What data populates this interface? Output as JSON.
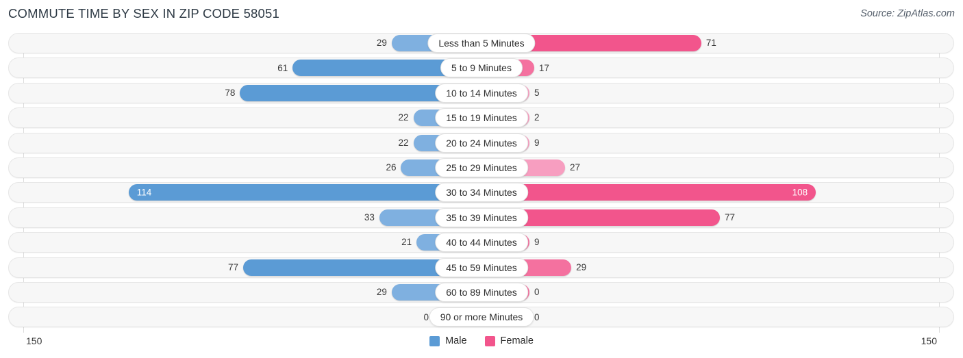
{
  "header": {
    "title": "COMMUTE TIME BY SEX IN ZIP CODE 58051",
    "source": "Source: ZipAtlas.com"
  },
  "axis": {
    "left_label": "150",
    "right_label": "150",
    "max": 150
  },
  "legend": {
    "items": [
      {
        "label": "Male",
        "color": "#5b9bd5"
      },
      {
        "label": "Female",
        "color": "#f2558c"
      }
    ]
  },
  "colors": {
    "male_strong": "#5b9bd5",
    "male_mid": "#7fb0e0",
    "male_light": "#a8c8ea",
    "female_strong": "#f2558c",
    "female_mid": "#f4719f",
    "female_light": "#f79ec0",
    "track": "#f7f7f7",
    "track_border": "#e6e6e6"
  },
  "chart_data": {
    "type": "bar",
    "title": "COMMUTE TIME BY SEX IN ZIP CODE 58051",
    "xlabel": "",
    "ylabel": "",
    "orientation": "horizontal-diverging",
    "xlim": [
      150,
      150
    ],
    "grid": true,
    "legend_position": "bottom-center",
    "categories": [
      "Less than 5 Minutes",
      "5 to 9 Minutes",
      "10 to 14 Minutes",
      "15 to 19 Minutes",
      "20 to 24 Minutes",
      "25 to 29 Minutes",
      "30 to 34 Minutes",
      "35 to 39 Minutes",
      "40 to 44 Minutes",
      "45 to 59 Minutes",
      "60 to 89 Minutes",
      "90 or more Minutes"
    ],
    "series": [
      {
        "name": "Male",
        "values": [
          29,
          61,
          78,
          22,
          22,
          26,
          114,
          33,
          21,
          77,
          29,
          0
        ]
      },
      {
        "name": "Female",
        "values": [
          71,
          17,
          5,
          2,
          9,
          27,
          108,
          77,
          9,
          29,
          0,
          0
        ]
      }
    ]
  },
  "rows": [
    {
      "label": "Less than 5 Minutes",
      "male": "29",
      "female": "71",
      "male_shade": "mid",
      "female_shade": "strong"
    },
    {
      "label": "5 to 9 Minutes",
      "male": "61",
      "female": "17",
      "male_shade": "strong",
      "female_shade": "mid"
    },
    {
      "label": "10 to 14 Minutes",
      "male": "78",
      "female": "5",
      "male_shade": "strong",
      "female_shade": "light"
    },
    {
      "label": "15 to 19 Minutes",
      "male": "22",
      "female": "2",
      "male_shade": "mid",
      "female_shade": "light"
    },
    {
      "label": "20 to 24 Minutes",
      "male": "22",
      "female": "9",
      "male_shade": "mid",
      "female_shade": "light"
    },
    {
      "label": "25 to 29 Minutes",
      "male": "26",
      "female": "27",
      "male_shade": "mid",
      "female_shade": "light"
    },
    {
      "label": "30 to 34 Minutes",
      "male": "114",
      "female": "108",
      "male_shade": "strong",
      "female_shade": "strong"
    },
    {
      "label": "35 to 39 Minutes",
      "male": "33",
      "female": "77",
      "male_shade": "mid",
      "female_shade": "strong"
    },
    {
      "label": "40 to 44 Minutes",
      "male": "21",
      "female": "9",
      "male_shade": "mid",
      "female_shade": "mid"
    },
    {
      "label": "45 to 59 Minutes",
      "male": "77",
      "female": "29",
      "male_shade": "strong",
      "female_shade": "mid"
    },
    {
      "label": "60 to 89 Minutes",
      "male": "29",
      "female": "0",
      "male_shade": "mid",
      "female_shade": "mid"
    },
    {
      "label": "90 or more Minutes",
      "male": "0",
      "female": "0",
      "male_shade": "light",
      "female_shade": "mid"
    }
  ]
}
